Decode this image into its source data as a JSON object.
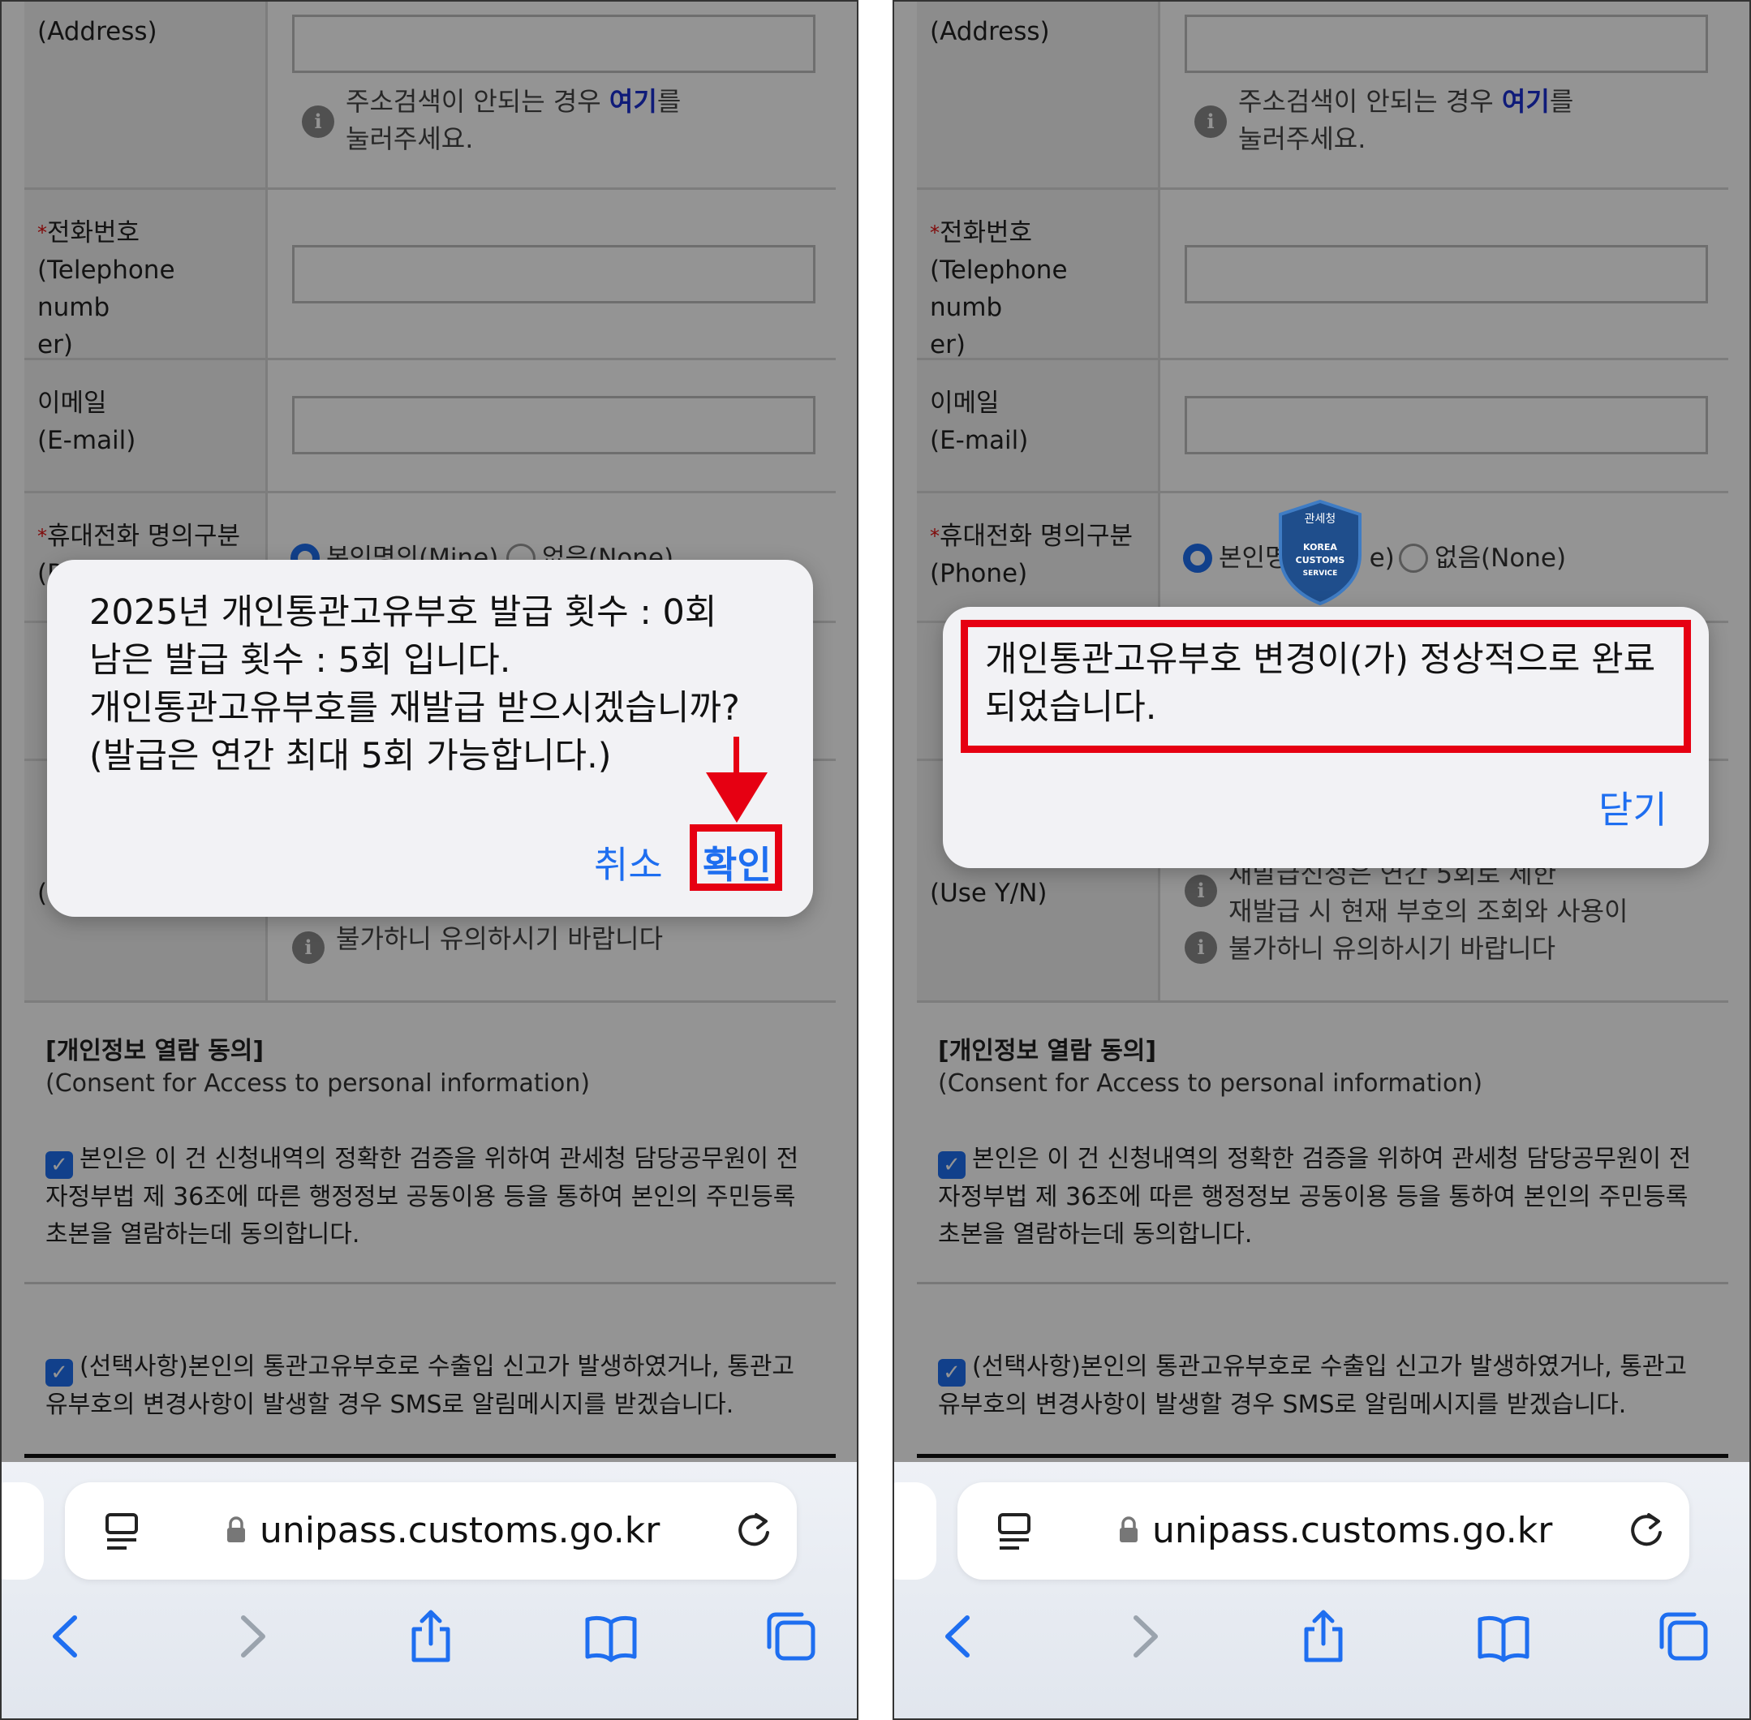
{
  "form": {
    "address_label": "(Address)",
    "address_help_prefix": "주소검색이 안되는 경우 ",
    "address_help_link": "여기",
    "address_help_suffix": "를",
    "address_help_line2": "눌러주세요.",
    "required_mark": "*",
    "phone_label_ko": "전화번호",
    "phone_label_en1": "(Telephone numb",
    "phone_label_en2": "er)",
    "email_label_ko": "이메일",
    "email_label_en": "(E-mail)",
    "mobile_label_ko": "휴대전화 명의구분",
    "mobile_label_en": "(Phone)",
    "radio_mine": "본인명의(Mine)",
    "radio_mine_partial": "본인명",
    "radio_mine_tail": "e)",
    "radio_none": "없음(None)",
    "use_label_en": "(Use Y/N)",
    "reissue_help1": "재발급신청은 연간 5회로 제한",
    "reissue_help2": "재발급 시 현재 부호의 조회와 사용이",
    "reissue_help3": "불가하니 유의하시기 바랍니다"
  },
  "consent": {
    "title": "[개인정보 열람 동의]",
    "subtitle": "(Consent for Access to personal information)",
    "text1_line1": "본인은 이 건 신청내역의 정확한 검증을 위하여 관세청 담당공무원이 전",
    "text1_line2": "자정부법 제 36조에 따른 행정정보 공동이용 등을 통하여 본인의 주민등록",
    "text1_line3": "초본을 열람하는데 동의합니다.",
    "text2_line1": "(선택사항)본인의 통관고유부호로 수출입 신고가 발생하였거나, 통관고",
    "text2_line2": "유부호의 변경사항이 발생할 경우 SMS로 알림메시지를 받겠습니다."
  },
  "browser": {
    "url": "unipass.customs.go.kr",
    "icons": [
      "reader-icon",
      "lock-icon",
      "reload-icon",
      "back-icon",
      "forward-icon",
      "share-icon",
      "bookmarks-icon",
      "tabs-icon"
    ]
  },
  "dialog_left": {
    "line1": "2025년 개인통관고유부호 발급 횟수 : 0회",
    "line2": "남은 발급 횟수 : 5회 입니다.",
    "line3": "개인통관고유부호를 재발급 받으시겠습니까?",
    "line4": "(발급은 연간 최대 5회 가능합니다.)",
    "cancel": "취소",
    "confirm": "확인"
  },
  "dialog_right": {
    "line1": "개인통관고유부호 변경이(가) 정상적으로 완료",
    "line2": "되었습니다.",
    "close": "닫기"
  },
  "emblem": {
    "top_text": "관세청",
    "line1": "KOREA",
    "line2": "CUSTOMS",
    "line3": "SERVICE"
  },
  "colors": {
    "accent": "#1e6ef0",
    "highlight": "#e60012",
    "link": "#1a2fd0"
  }
}
